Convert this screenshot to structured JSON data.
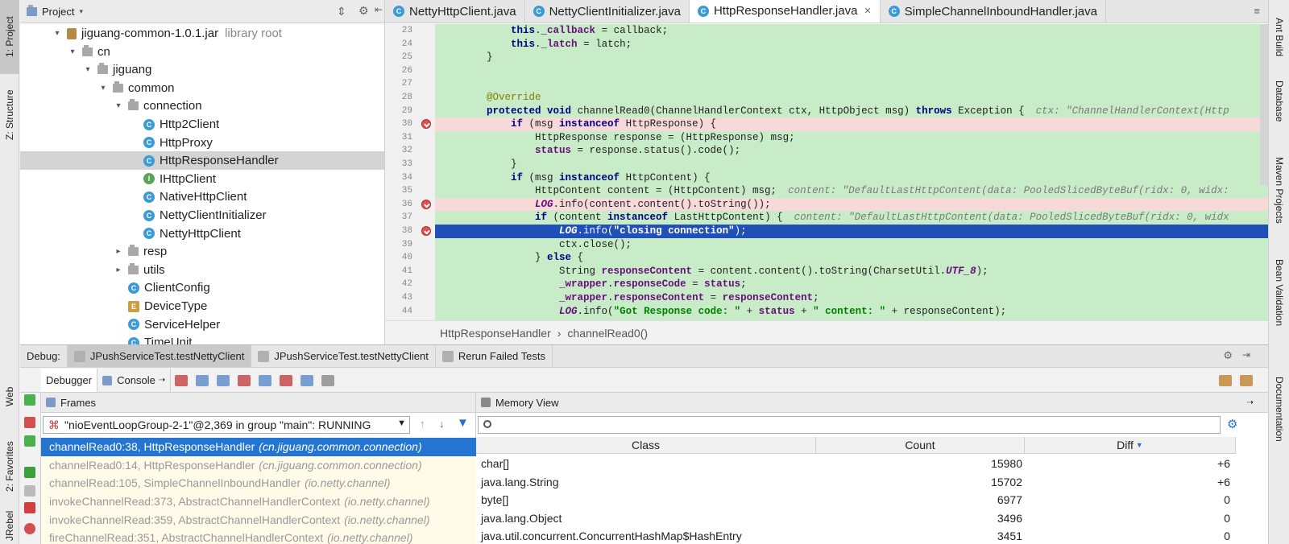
{
  "left_stripe": {
    "project": "1: Project",
    "structure": "Z: Structure",
    "web": "Web",
    "favorites": "2: Favorites",
    "jrebel": "JRebel"
  },
  "right_stripe": {
    "ant": "Ant Build",
    "database": "Database",
    "maven": "Maven Projects",
    "bean": "Bean Validation",
    "doc": "Documentation"
  },
  "project": {
    "title": "Project",
    "tree": [
      {
        "label": "jiguang-common-1.0.1.jar",
        "hint": "library root",
        "indent": 0,
        "arrow": "▾",
        "icon": "jar"
      },
      {
        "label": "cn",
        "indent": 1,
        "arrow": "▾",
        "icon": "pkg"
      },
      {
        "label": "jiguang",
        "indent": 2,
        "arrow": "▾",
        "icon": "pkg"
      },
      {
        "label": "common",
        "indent": 3,
        "arrow": "▾",
        "icon": "pkg"
      },
      {
        "label": "connection",
        "indent": 4,
        "arrow": "▾",
        "icon": "pkg"
      },
      {
        "label": "Http2Client",
        "indent": 5,
        "arrow": "",
        "icon": "c"
      },
      {
        "label": "HttpProxy",
        "indent": 5,
        "arrow": "",
        "icon": "c"
      },
      {
        "label": "HttpResponseHandler",
        "indent": 5,
        "arrow": "",
        "icon": "c",
        "selected": true
      },
      {
        "label": "IHttpClient",
        "indent": 5,
        "arrow": "",
        "icon": "i"
      },
      {
        "label": "NativeHttpClient",
        "indent": 5,
        "arrow": "",
        "icon": "c"
      },
      {
        "label": "NettyClientInitializer",
        "indent": 5,
        "arrow": "",
        "icon": "c"
      },
      {
        "label": "NettyHttpClient",
        "indent": 5,
        "arrow": "",
        "icon": "c"
      },
      {
        "label": "resp",
        "indent": 4,
        "arrow": "▸",
        "icon": "pkg"
      },
      {
        "label": "utils",
        "indent": 4,
        "arrow": "▸",
        "icon": "pkg"
      },
      {
        "label": "ClientConfig",
        "indent": 4,
        "arrow": "",
        "icon": "c"
      },
      {
        "label": "DeviceType",
        "indent": 4,
        "arrow": "",
        "icon": "e"
      },
      {
        "label": "ServiceHelper",
        "indent": 4,
        "arrow": "",
        "icon": "c"
      },
      {
        "label": "TimeUnit",
        "indent": 4,
        "arrow": "",
        "icon": "c"
      }
    ]
  },
  "editor": {
    "tabs": [
      {
        "label": "NettyHttpClient.java",
        "active": false
      },
      {
        "label": "NettyClientInitializer.java",
        "active": false
      },
      {
        "label": "HttpResponseHandler.java",
        "active": true
      },
      {
        "label": "SimpleChannelInboundHandler.java",
        "active": false
      }
    ],
    "lines": [
      {
        "n": "23",
        "code": "        this._callback = callback;"
      },
      {
        "n": "24",
        "code": "        this._latch = latch;"
      },
      {
        "n": "25",
        "code": "    }"
      },
      {
        "n": "26",
        "code": ""
      },
      {
        "n": "27",
        "code": ""
      },
      {
        "n": "28",
        "code": "    @Override"
      },
      {
        "n": "29",
        "code": "    protected void channelRead0(ChannelHandlerContext ctx, HttpObject msg) throws Exception {",
        "debug": "ctx: \"ChannelHandlerContext(Http"
      },
      {
        "n": "30",
        "code": "        if (msg instanceof HttpResponse) {",
        "bp": true
      },
      {
        "n": "31",
        "code": "            HttpResponse response = (HttpResponse) msg;"
      },
      {
        "n": "32",
        "code": "            status = response.status().code();"
      },
      {
        "n": "33",
        "code": "        }"
      },
      {
        "n": "34",
        "code": "        if (msg instanceof HttpContent) {"
      },
      {
        "n": "35",
        "code": "            HttpContent content = (HttpContent) msg;",
        "debug": "content: \"DefaultLastHttpContent(data: PooledSlicedByteBuf(ridx: 0, widx:"
      },
      {
        "n": "36",
        "code": "            LOG.info(content.content().toString());",
        "bp": true
      },
      {
        "n": "37",
        "code": "            if (content instanceof LastHttpContent) {",
        "debug": "content: \"DefaultLastHttpContent(data: PooledSlicedByteBuf(ridx: 0, widx"
      },
      {
        "n": "38",
        "code": "                LOG.info(\"closing connection\");",
        "bp": true,
        "current": true
      },
      {
        "n": "39",
        "code": "                ctx.close();"
      },
      {
        "n": "40",
        "code": "            } else {"
      },
      {
        "n": "41",
        "code": "                String responseContent = content.content().toString(CharsetUtil.UTF_8);"
      },
      {
        "n": "42",
        "code": "                _wrapper.responseCode = status;"
      },
      {
        "n": "43",
        "code": "                _wrapper.responseContent = responseContent;"
      },
      {
        "n": "44",
        "code": "                LOG.info(\"Got Response code: \" + status + \" content: \" + responseContent);"
      }
    ],
    "breadcrumb": [
      "HttpResponseHandler",
      "channelRead0()"
    ]
  },
  "debug": {
    "label": "Debug:",
    "tabs": [
      {
        "label": "JPushServiceTest.testNettyClient",
        "active": true
      },
      {
        "label": "JPushServiceTest.testNettyClient",
        "active": false
      },
      {
        "label": "Rerun Failed Tests",
        "active": false
      }
    ],
    "subtabs": {
      "debugger": "Debugger",
      "console": "Console"
    },
    "frames": {
      "title": "Frames",
      "thread": "\"nioEventLoopGroup-2-1\"@2,369 in group \"main\": RUNNING",
      "items": [
        {
          "method": "channelRead0:38, HttpResponseHandler",
          "pkg": "(cn.jiguang.common.connection)",
          "selected": true
        },
        {
          "method": "channelRead0:14, HttpResponseHandler",
          "pkg": "(cn.jiguang.common.connection)"
        },
        {
          "method": "channelRead:105, SimpleChannelInboundHandler",
          "pkg": "(io.netty.channel)"
        },
        {
          "method": "invokeChannelRead:373, AbstractChannelHandlerContext",
          "pkg": "(io.netty.channel)"
        },
        {
          "method": "invokeChannelRead:359, AbstractChannelHandlerContext",
          "pkg": "(io.netty.channel)"
        },
        {
          "method": "fireChannelRead:351, AbstractChannelHandlerContext",
          "pkg": "(io.netty.channel)"
        }
      ]
    },
    "memory": {
      "title": "Memory View",
      "columns": {
        "class": "Class",
        "count": "Count",
        "diff": "Diff"
      },
      "rows": [
        {
          "class": "char[]",
          "count": "15980",
          "diff": "+6"
        },
        {
          "class": "java.lang.String",
          "count": "15702",
          "diff": "+6"
        },
        {
          "class": "byte[]",
          "count": "6977",
          "diff": "0"
        },
        {
          "class": "java.lang.Object",
          "count": "3496",
          "diff": "0"
        },
        {
          "class": "java.util.concurrent.ConcurrentHashMap$HashEntry",
          "count": "3451",
          "diff": "0"
        }
      ]
    }
  }
}
